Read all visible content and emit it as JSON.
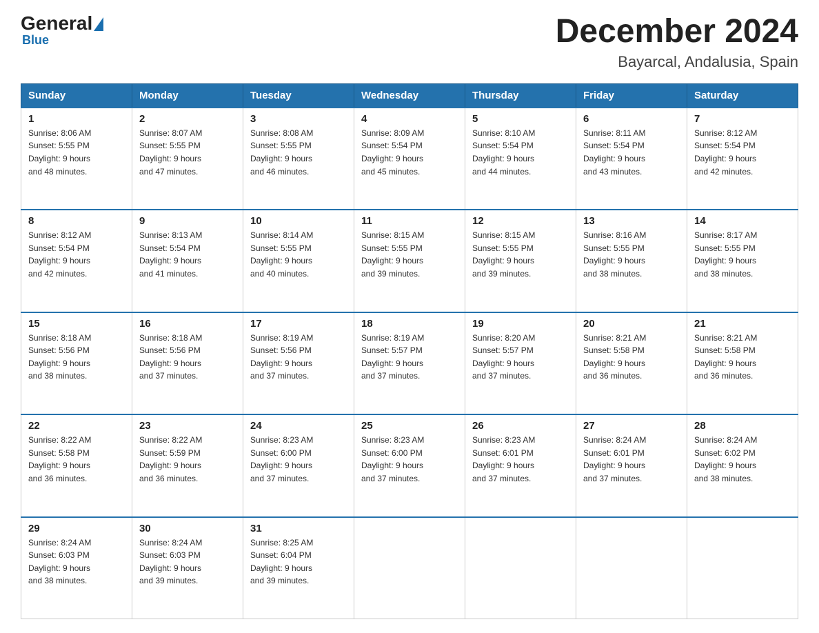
{
  "header": {
    "logo_general": "General",
    "logo_blue": "Blue",
    "title": "December 2024",
    "subtitle": "Bayarcal, Andalusia, Spain"
  },
  "days_of_week": [
    "Sunday",
    "Monday",
    "Tuesday",
    "Wednesday",
    "Thursday",
    "Friday",
    "Saturday"
  ],
  "weeks": [
    [
      {
        "day": "1",
        "sunrise": "8:06 AM",
        "sunset": "5:55 PM",
        "daylight": "9 hours and 48 minutes."
      },
      {
        "day": "2",
        "sunrise": "8:07 AM",
        "sunset": "5:55 PM",
        "daylight": "9 hours and 47 minutes."
      },
      {
        "day": "3",
        "sunrise": "8:08 AM",
        "sunset": "5:55 PM",
        "daylight": "9 hours and 46 minutes."
      },
      {
        "day": "4",
        "sunrise": "8:09 AM",
        "sunset": "5:54 PM",
        "daylight": "9 hours and 45 minutes."
      },
      {
        "day": "5",
        "sunrise": "8:10 AM",
        "sunset": "5:54 PM",
        "daylight": "9 hours and 44 minutes."
      },
      {
        "day": "6",
        "sunrise": "8:11 AM",
        "sunset": "5:54 PM",
        "daylight": "9 hours and 43 minutes."
      },
      {
        "day": "7",
        "sunrise": "8:12 AM",
        "sunset": "5:54 PM",
        "daylight": "9 hours and 42 minutes."
      }
    ],
    [
      {
        "day": "8",
        "sunrise": "8:12 AM",
        "sunset": "5:54 PM",
        "daylight": "9 hours and 42 minutes."
      },
      {
        "day": "9",
        "sunrise": "8:13 AM",
        "sunset": "5:54 PM",
        "daylight": "9 hours and 41 minutes."
      },
      {
        "day": "10",
        "sunrise": "8:14 AM",
        "sunset": "5:55 PM",
        "daylight": "9 hours and 40 minutes."
      },
      {
        "day": "11",
        "sunrise": "8:15 AM",
        "sunset": "5:55 PM",
        "daylight": "9 hours and 39 minutes."
      },
      {
        "day": "12",
        "sunrise": "8:15 AM",
        "sunset": "5:55 PM",
        "daylight": "9 hours and 39 minutes."
      },
      {
        "day": "13",
        "sunrise": "8:16 AM",
        "sunset": "5:55 PM",
        "daylight": "9 hours and 38 minutes."
      },
      {
        "day": "14",
        "sunrise": "8:17 AM",
        "sunset": "5:55 PM",
        "daylight": "9 hours and 38 minutes."
      }
    ],
    [
      {
        "day": "15",
        "sunrise": "8:18 AM",
        "sunset": "5:56 PM",
        "daylight": "9 hours and 38 minutes."
      },
      {
        "day": "16",
        "sunrise": "8:18 AM",
        "sunset": "5:56 PM",
        "daylight": "9 hours and 37 minutes."
      },
      {
        "day": "17",
        "sunrise": "8:19 AM",
        "sunset": "5:56 PM",
        "daylight": "9 hours and 37 minutes."
      },
      {
        "day": "18",
        "sunrise": "8:19 AM",
        "sunset": "5:57 PM",
        "daylight": "9 hours and 37 minutes."
      },
      {
        "day": "19",
        "sunrise": "8:20 AM",
        "sunset": "5:57 PM",
        "daylight": "9 hours and 37 minutes."
      },
      {
        "day": "20",
        "sunrise": "8:21 AM",
        "sunset": "5:58 PM",
        "daylight": "9 hours and 36 minutes."
      },
      {
        "day": "21",
        "sunrise": "8:21 AM",
        "sunset": "5:58 PM",
        "daylight": "9 hours and 36 minutes."
      }
    ],
    [
      {
        "day": "22",
        "sunrise": "8:22 AM",
        "sunset": "5:58 PM",
        "daylight": "9 hours and 36 minutes."
      },
      {
        "day": "23",
        "sunrise": "8:22 AM",
        "sunset": "5:59 PM",
        "daylight": "9 hours and 36 minutes."
      },
      {
        "day": "24",
        "sunrise": "8:23 AM",
        "sunset": "6:00 PM",
        "daylight": "9 hours and 37 minutes."
      },
      {
        "day": "25",
        "sunrise": "8:23 AM",
        "sunset": "6:00 PM",
        "daylight": "9 hours and 37 minutes."
      },
      {
        "day": "26",
        "sunrise": "8:23 AM",
        "sunset": "6:01 PM",
        "daylight": "9 hours and 37 minutes."
      },
      {
        "day": "27",
        "sunrise": "8:24 AM",
        "sunset": "6:01 PM",
        "daylight": "9 hours and 37 minutes."
      },
      {
        "day": "28",
        "sunrise": "8:24 AM",
        "sunset": "6:02 PM",
        "daylight": "9 hours and 38 minutes."
      }
    ],
    [
      {
        "day": "29",
        "sunrise": "8:24 AM",
        "sunset": "6:03 PM",
        "daylight": "9 hours and 38 minutes."
      },
      {
        "day": "30",
        "sunrise": "8:24 AM",
        "sunset": "6:03 PM",
        "daylight": "9 hours and 39 minutes."
      },
      {
        "day": "31",
        "sunrise": "8:25 AM",
        "sunset": "6:04 PM",
        "daylight": "9 hours and 39 minutes."
      },
      null,
      null,
      null,
      null
    ]
  ],
  "labels": {
    "sunrise": "Sunrise:",
    "sunset": "Sunset:",
    "daylight": "Daylight:"
  }
}
